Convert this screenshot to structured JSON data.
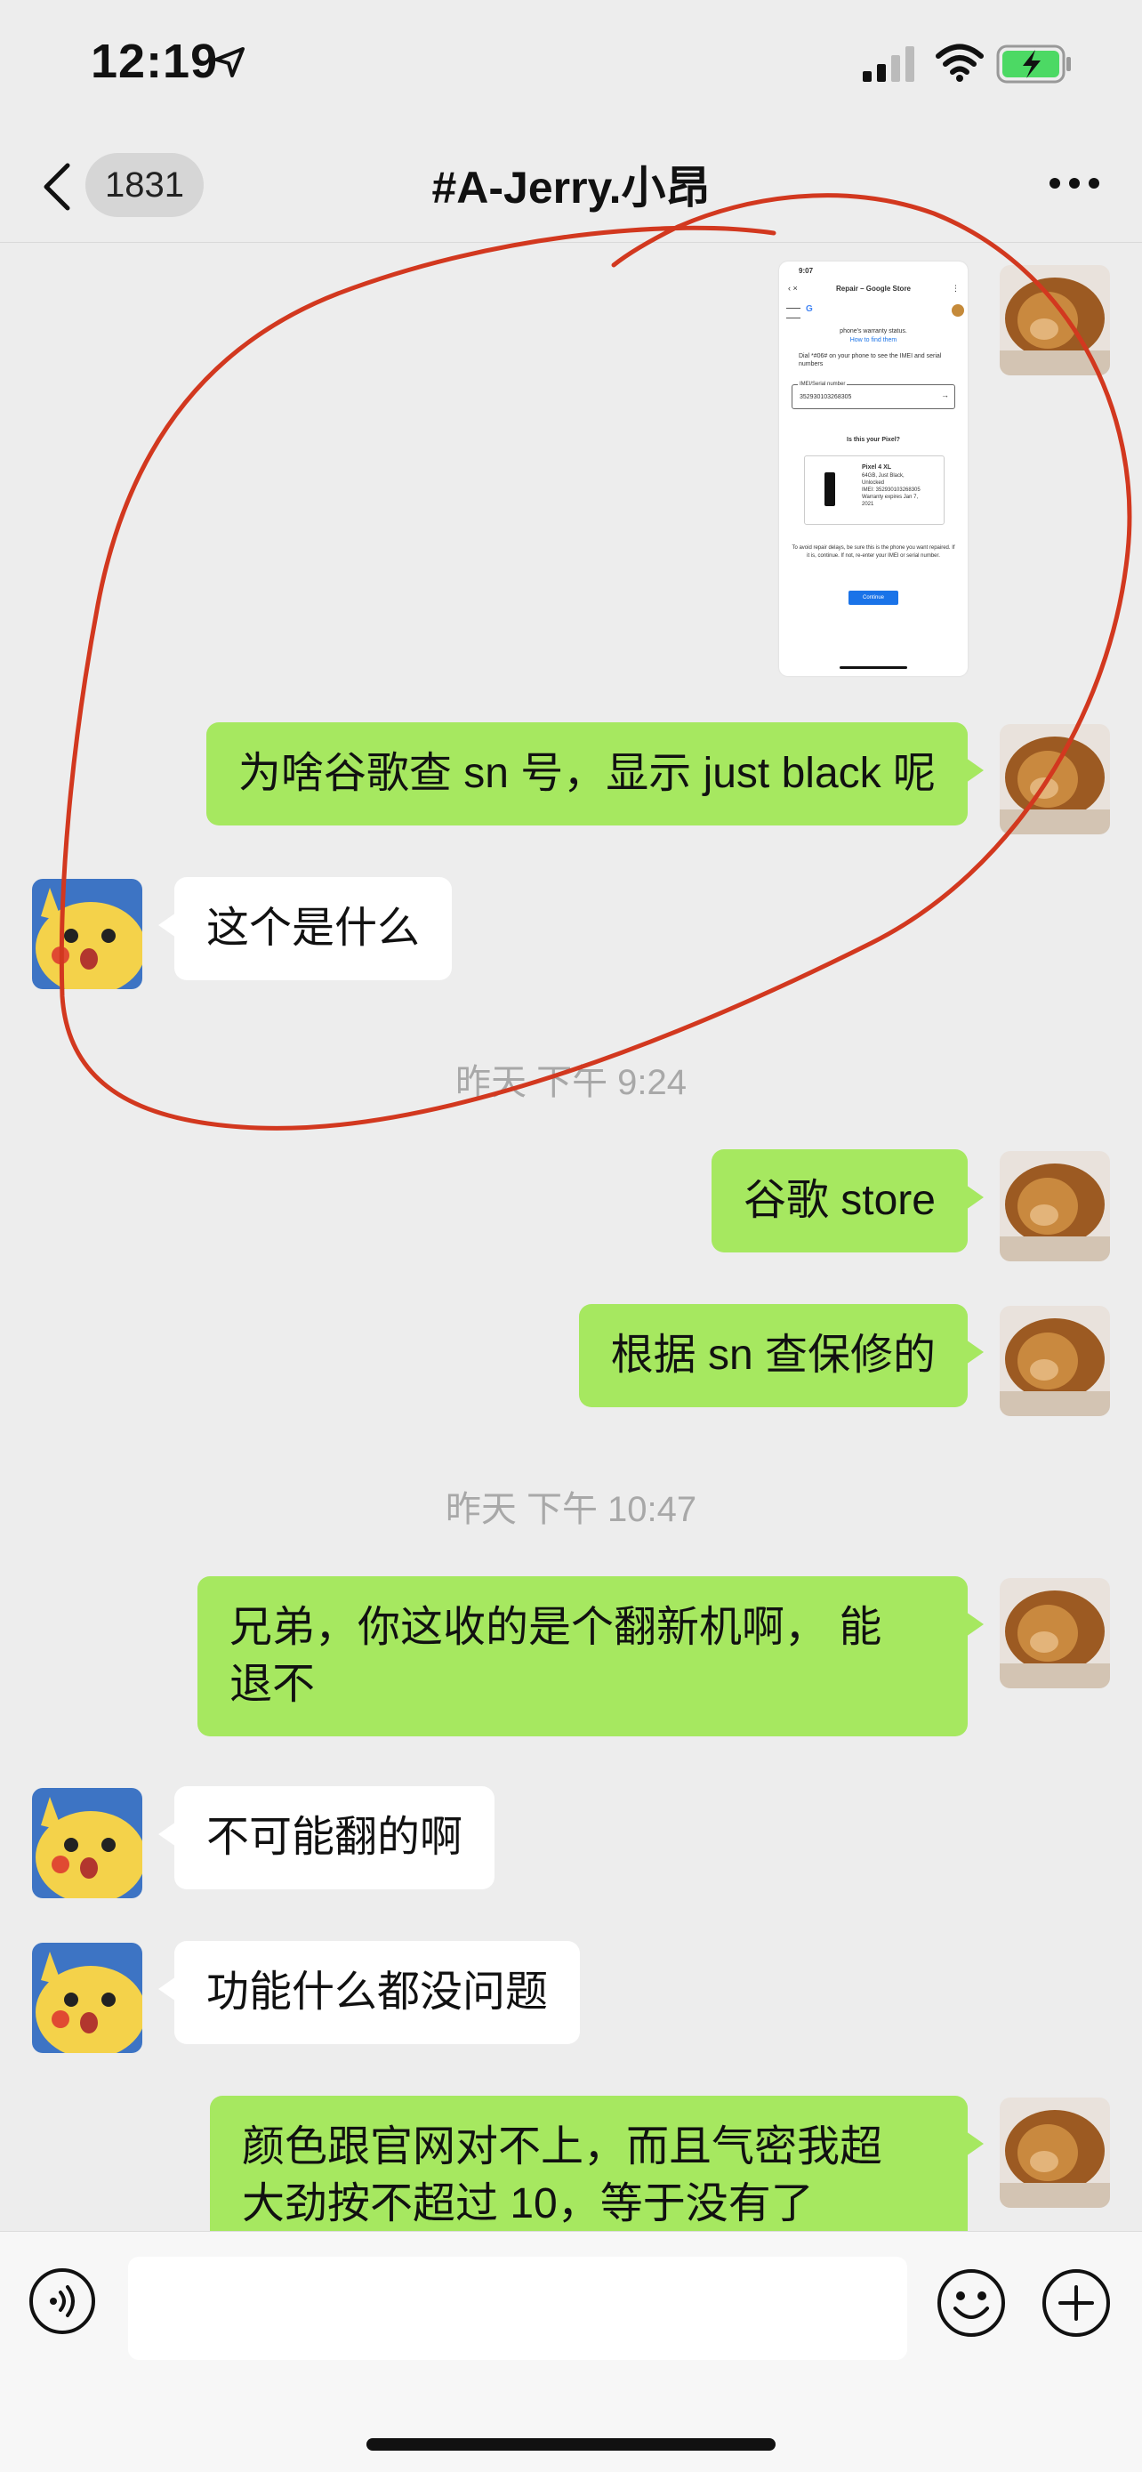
{
  "status": {
    "time": "12:19",
    "battery_color": "#4cd964"
  },
  "nav": {
    "badge": "1831",
    "title": "#A-Jerry.小昂"
  },
  "shared_screenshot": {
    "time": "9:07",
    "page_title": "Repair – Google Store",
    "line1": "phone's warranty status.",
    "link1": "How to find them",
    "dial_text": "Dial *#06# on your phone to see the IMEI and serial numbers",
    "field_label": "IMEI/Serial number",
    "field_value": "352930103268305",
    "question": "Is this your Pixel?",
    "device_name": "Pixel 4 XL",
    "device_line1": "64GB, Just Black,",
    "device_line2": "Unlocked",
    "device_line3": "IMEI: 352930103268305",
    "device_line4": "Warranty expires Jan 7,",
    "device_line5": "2021",
    "note": "To avoid repair delays, be sure this is the phone you want repaired. If it is, continue. If not, re-enter your IMEI or serial number.",
    "button": "Continue"
  },
  "messages": {
    "m1": "为啥谷歌查 sn 号，显示 just black 呢",
    "m2": "这个是什么",
    "t1": "昨天 下午 9:24",
    "m3": "谷歌 store",
    "m4": "根据 sn 查保修的",
    "t2": "昨天 下午 10:47",
    "m5_l1": "兄弟，你这收的是个翻新机啊， 能",
    "m5_l2": "退不",
    "m6": "不可能翻的啊",
    "m7": "功能什么都没问题",
    "m8_l1": "颜色跟官网对不上，而且气密我超",
    "m8_l2": "大劲按不超过 10，等于没有了"
  },
  "colors": {
    "my_bubble": "#a6e860",
    "their_bubble": "#ffffff",
    "background": "#ededed",
    "annotation_stroke": "#d2381f"
  },
  "icons": [
    "location-arrow-icon",
    "signal-icon",
    "wifi-icon",
    "battery-icon",
    "back-chevron-icon",
    "more-icon",
    "voice-icon",
    "emoji-icon",
    "plus-icon",
    "lion-avatar",
    "pikachu-avatar"
  ]
}
